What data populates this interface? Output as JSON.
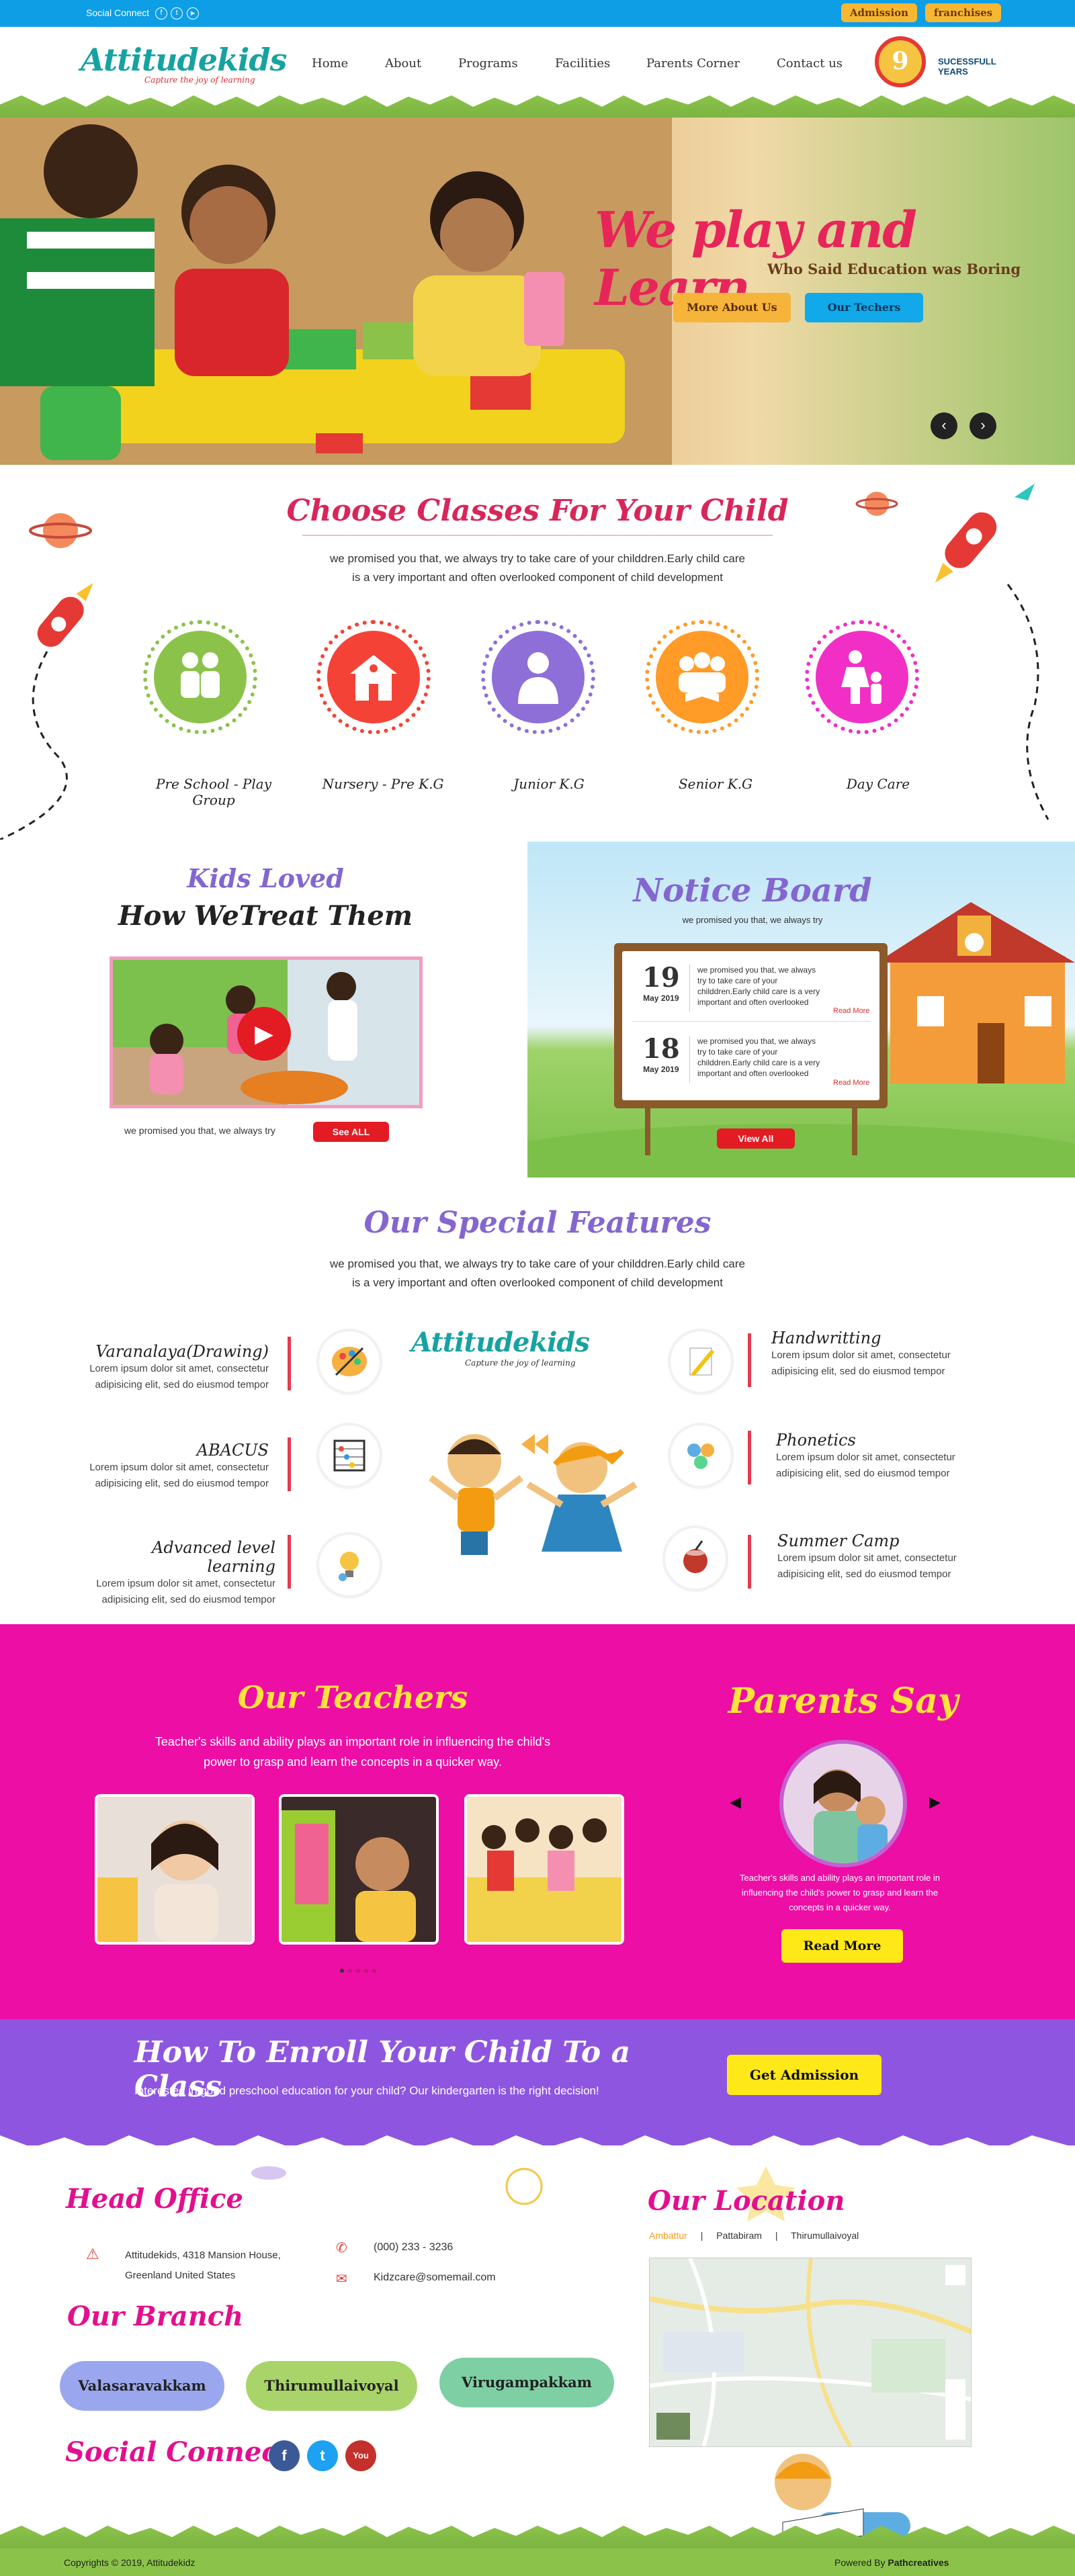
{
  "topbar": {
    "social_label": "Social Connect",
    "admission_label": "Admission",
    "franchises_label": "franchises"
  },
  "brand": {
    "logo_text": "Attitudekids",
    "tagline": "Capture the joy of learning",
    "years_number": "9",
    "years_label": "SUCESSFULL YEARS"
  },
  "nav": {
    "items": [
      "Home",
      "About",
      "Programs",
      "Facilities",
      "Parents Corner",
      "Contact us"
    ]
  },
  "hero": {
    "title": "We play and Learn",
    "subtitle": "Who Said Education was Boring",
    "btn_more": "More About Us",
    "btn_teachers": "Our Techers",
    "prev_icon": "chevron-left-icon",
    "next_icon": "chevron-right-icon"
  },
  "classes": {
    "title": "Choose Classes For Your Child",
    "description_line1": "we promised you that, we always try to take care of your childdren.Early child care",
    "description_line2": "is a very important and often overlooked component of child development",
    "items": [
      {
        "label": "Pre School - Play Group",
        "color": "#8bc34a",
        "icon": "kids-icon"
      },
      {
        "label": "Nursery - Pre K.G",
        "color": "#f44336",
        "icon": "school-icon"
      },
      {
        "label": "Junior K.G",
        "color": "#8e6fd8",
        "icon": "student-icon"
      },
      {
        "label": "Senior K.G",
        "color": "#ff9b26",
        "icon": "group-reading-icon"
      },
      {
        "label": "Day Care",
        "color": "#f12fc7",
        "icon": "parent-child-icon"
      }
    ]
  },
  "kids_loved": {
    "title_line1": "Kids Loved",
    "title_line2": "How WeTreat Them",
    "caption": "we promised you that, we always try",
    "see_all": "See ALL"
  },
  "notice": {
    "title": "Notice Board",
    "subtitle": "we promised you that, we always try",
    "items": [
      {
        "day": "19",
        "month": "May 2019",
        "text": "we promised you that, we always try to take care of your childdren.Early child care is a very important and often overlooked",
        "more": "Read More"
      },
      {
        "day": "18",
        "month": "May 2019",
        "text": "we promised you that, we always try to take care of your childdren.Early child care is a very important and often overlooked",
        "more": "Read More"
      }
    ],
    "view_all": "View All"
  },
  "features": {
    "title": "Our Special Features",
    "description_line1": "we promised you that, we always try to take care of your childdren.Early child care",
    "description_line2": "is a very important and often overlooked component of child development",
    "left": [
      {
        "title": "Varanalaya(Drawing)",
        "text1": "Lorem ipsum dolor sit amet, consectetur",
        "text2": "adipisicing elit, sed do eiusmod tempor",
        "icon": "palette-icon"
      },
      {
        "title": "ABACUS",
        "text1": "Lorem ipsum dolor sit amet, consectetur",
        "text2": "adipisicing elit, sed do eiusmod tempor",
        "icon": "abacus-icon"
      },
      {
        "title": "Advanced level learning",
        "text1": "Lorem ipsum dolor sit amet, consectetur",
        "text2": "adipisicing elit, sed do eiusmod tempor",
        "icon": "lightbulb-icon"
      }
    ],
    "right": [
      {
        "title": "Handwritting",
        "text1": "Lorem ipsum dolor sit amet, consectetur",
        "text2": "adipisicing elit, sed do eiusmod tempor",
        "icon": "pencil-icon"
      },
      {
        "title": "Phonetics",
        "text1": "Lorem ipsum dolor sit amet, consectetur",
        "text2": "adipisicing elit, sed do eiusmod tempor",
        "icon": "phonetics-icon"
      },
      {
        "title": "Summer Camp",
        "text1": "Lorem ipsum dolor sit amet, consectetur",
        "text2": "adipisicing elit, sed do eiusmod tempor",
        "icon": "coconut-drink-icon"
      }
    ]
  },
  "teachers": {
    "title": "Our Teachers",
    "description_line1": "Teacher's skills and ability plays an important role in influencing the child's",
    "description_line2": "power to grasp and learn the concepts in a quicker way."
  },
  "parents": {
    "title": "Parents Say",
    "text_line1": "Teacher's skills and ability plays an important role in",
    "text_line2": "influencing the child's power to grasp and learn the",
    "text_line3": "concepts in a quicker way.",
    "read_more": "Read More"
  },
  "enroll": {
    "title": "How To Enroll Your Child To a Class",
    "text": "Interested in good preschool education for your child? Our kindergarten is the right decision!",
    "button": "Get Admission"
  },
  "head_office": {
    "title": "Head Office",
    "address_line1": "Attitudekids, 4318 Mansion House,",
    "address_line2": "Greenland United States",
    "phone": "(000) 233 - 3236",
    "email": "Kidzcare@somemail.com"
  },
  "branch": {
    "title": "Our Branch",
    "items": [
      {
        "name": "Valasaravakkam",
        "color": "#9aa7ef"
      },
      {
        "name": "Thirumullaivoyal",
        "color": "#a8d469"
      },
      {
        "name": "Virugampakkam",
        "color": "#7fcfa5"
      }
    ]
  },
  "social": {
    "title": "Social Connect",
    "facebook": "f",
    "twitter": "t",
    "youtube": "You"
  },
  "location": {
    "title": "Our Location",
    "tabs": [
      "Ambattur",
      "Pattabiram",
      "Thirumullaivoyal"
    ],
    "active_tab": "Ambattur"
  },
  "footer": {
    "copyright": "Copyrights © 2019, Attitudekidz",
    "powered_prefix": "Powered By ",
    "powered_by": "Pathcreatives"
  }
}
